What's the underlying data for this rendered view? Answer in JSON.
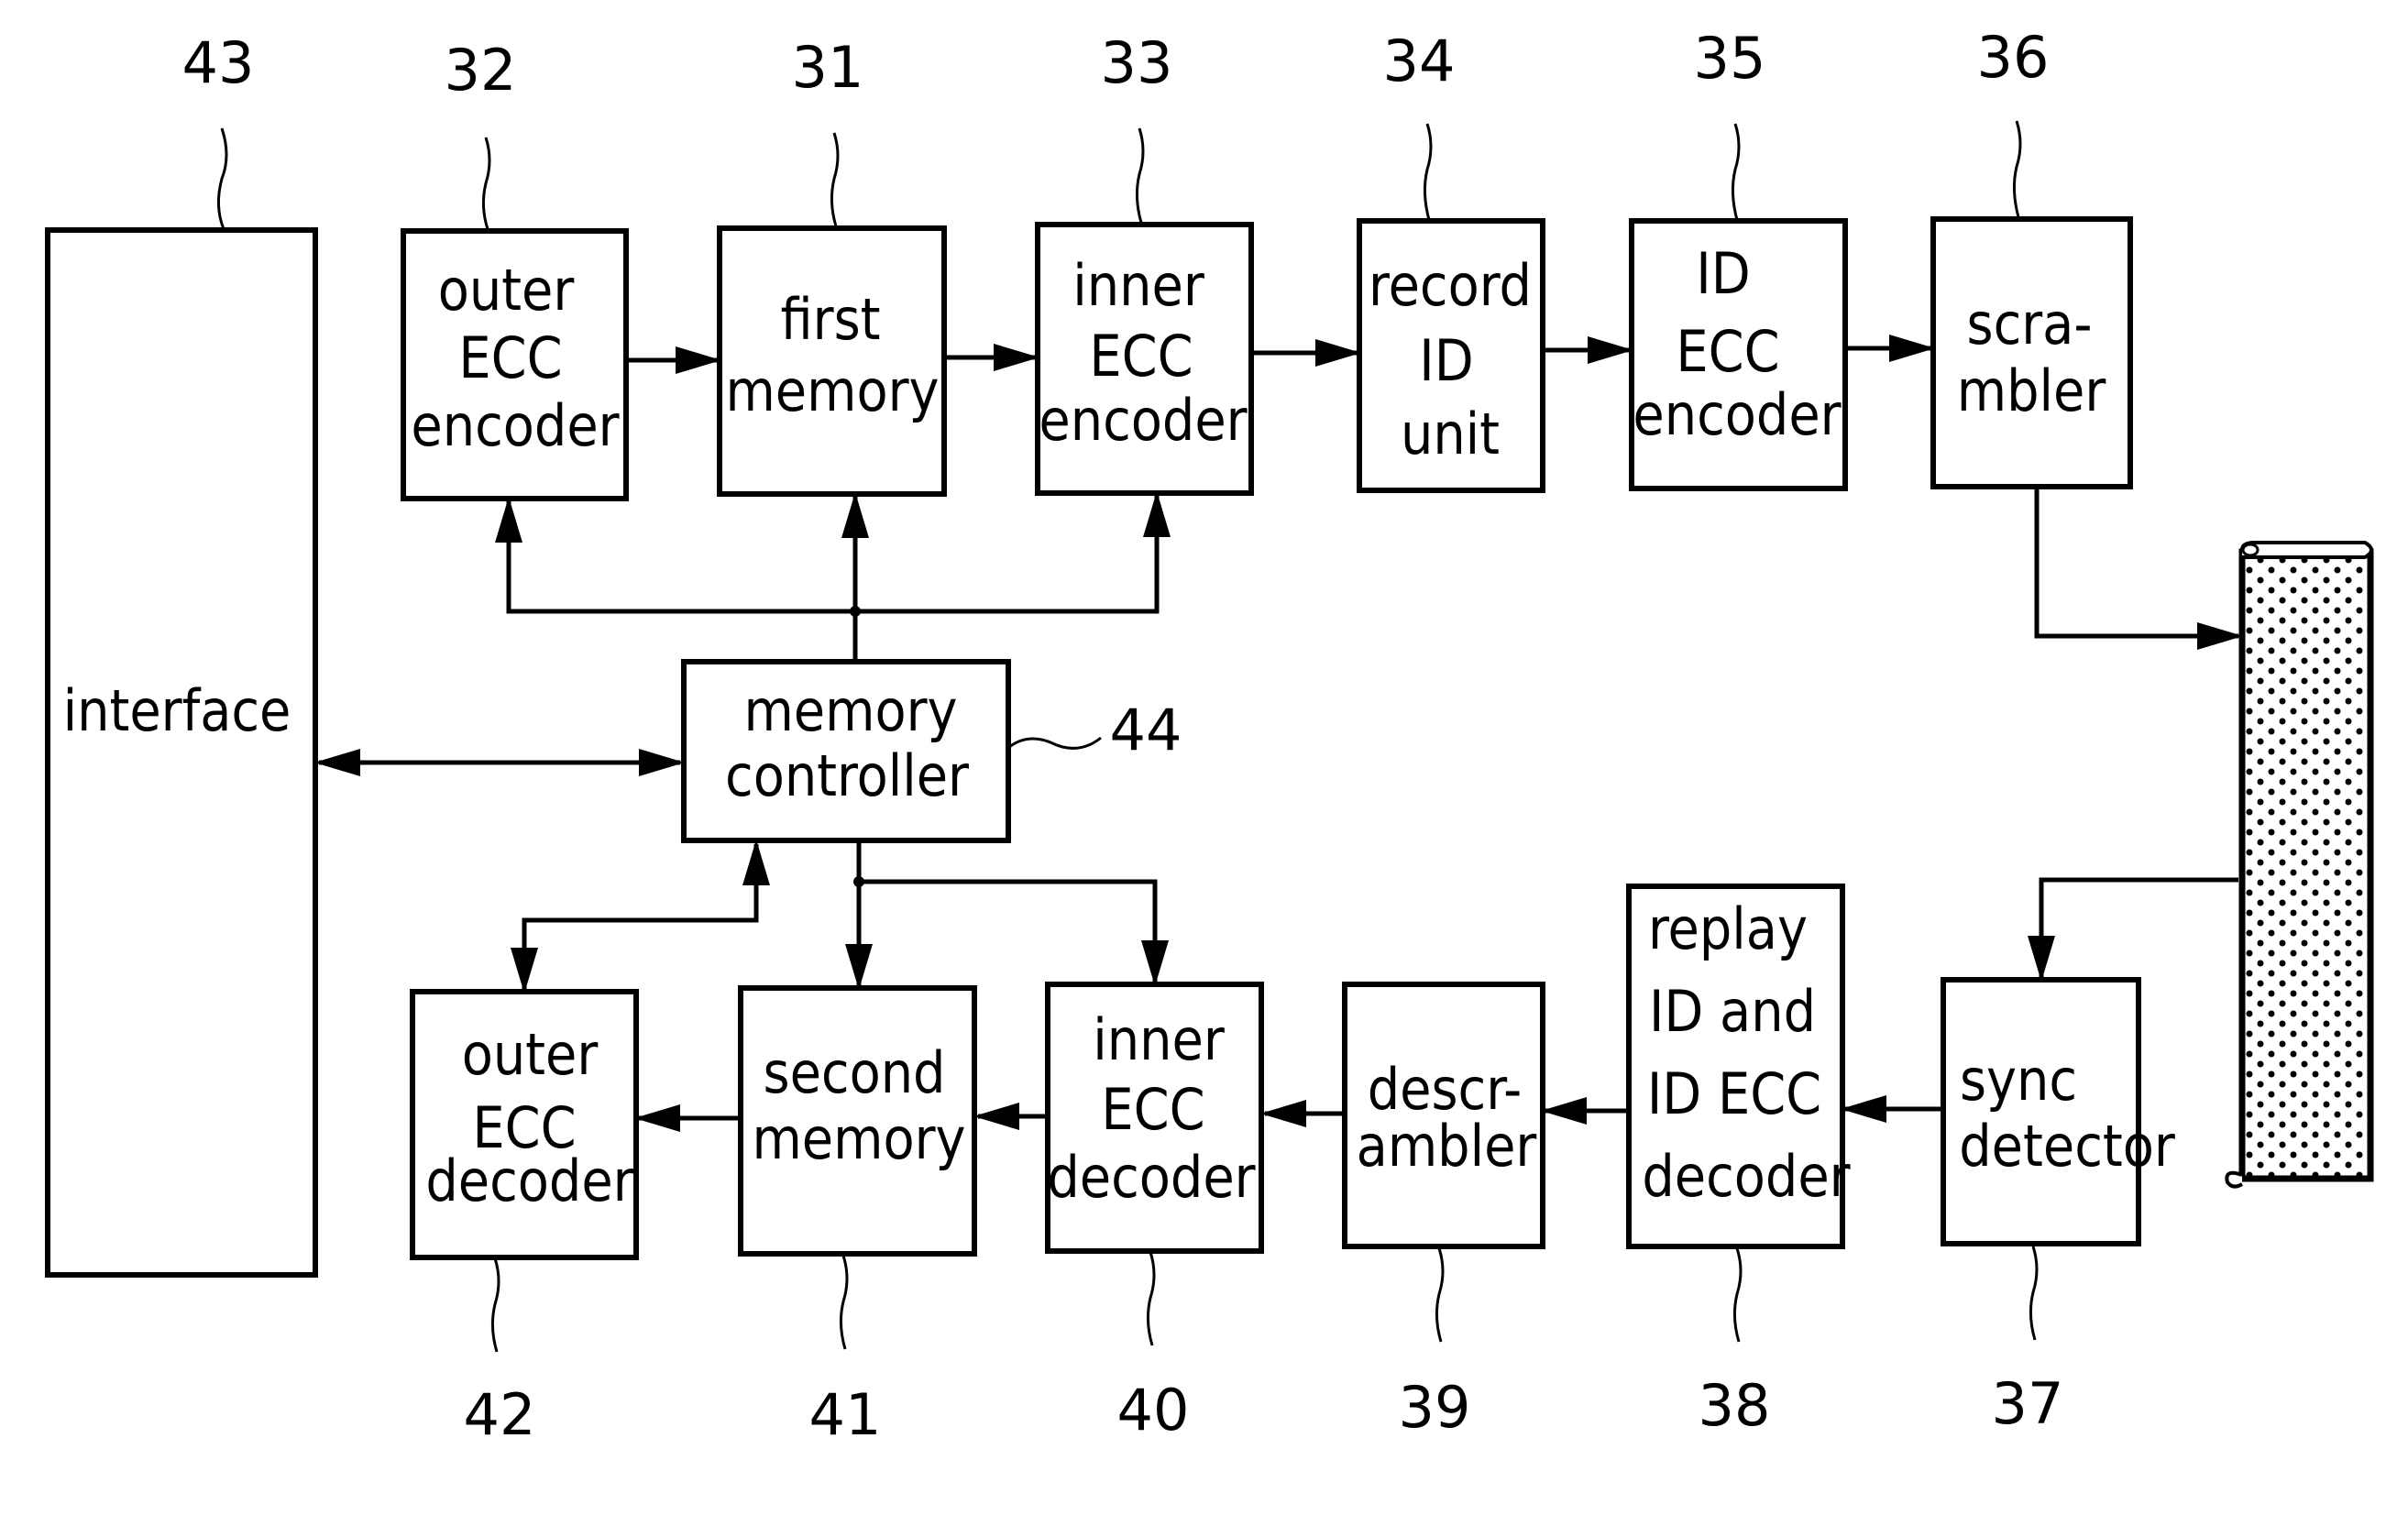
{
  "blocks": {
    "interface": {
      "ref": "43",
      "lines": [
        "interface"
      ]
    },
    "outer_ecc_encoder": {
      "ref": "32",
      "lines": [
        "outer",
        "ECC",
        "encoder"
      ]
    },
    "first_memory": {
      "ref": "31",
      "lines": [
        "first",
        "memory"
      ]
    },
    "inner_ecc_encoder": {
      "ref": "33",
      "lines": [
        "inner",
        "ECC",
        "encoder"
      ]
    },
    "record_id_unit": {
      "ref": "34",
      "lines": [
        "record",
        "ID",
        "unit"
      ]
    },
    "id_ecc_encoder": {
      "ref": "35",
      "lines": [
        "ID",
        "ECC",
        "encoder"
      ]
    },
    "scrambler": {
      "ref": "36",
      "lines": [
        "scra-",
        "mbler"
      ]
    },
    "memory_controller": {
      "ref": "44",
      "lines": [
        "memory",
        "controller"
      ]
    },
    "outer_ecc_decoder": {
      "ref": "42",
      "lines": [
        "outer",
        "ECC",
        "decoder"
      ]
    },
    "second_memory": {
      "ref": "41",
      "lines": [
        "second",
        "memory"
      ]
    },
    "inner_ecc_decoder": {
      "ref": "40",
      "lines": [
        "inner",
        "ECC",
        "decoder"
      ]
    },
    "descrambler": {
      "ref": "39",
      "lines": [
        "descr-",
        "ambler"
      ]
    },
    "replay_id_decoder": {
      "ref": "38",
      "lines": [
        "replay",
        "ID  and",
        "ID  ECC",
        "decoder"
      ]
    },
    "sync_detector": {
      "ref": "37",
      "lines": [
        "sync",
        "detector"
      ]
    }
  },
  "medium": {
    "name": "recording tape"
  }
}
